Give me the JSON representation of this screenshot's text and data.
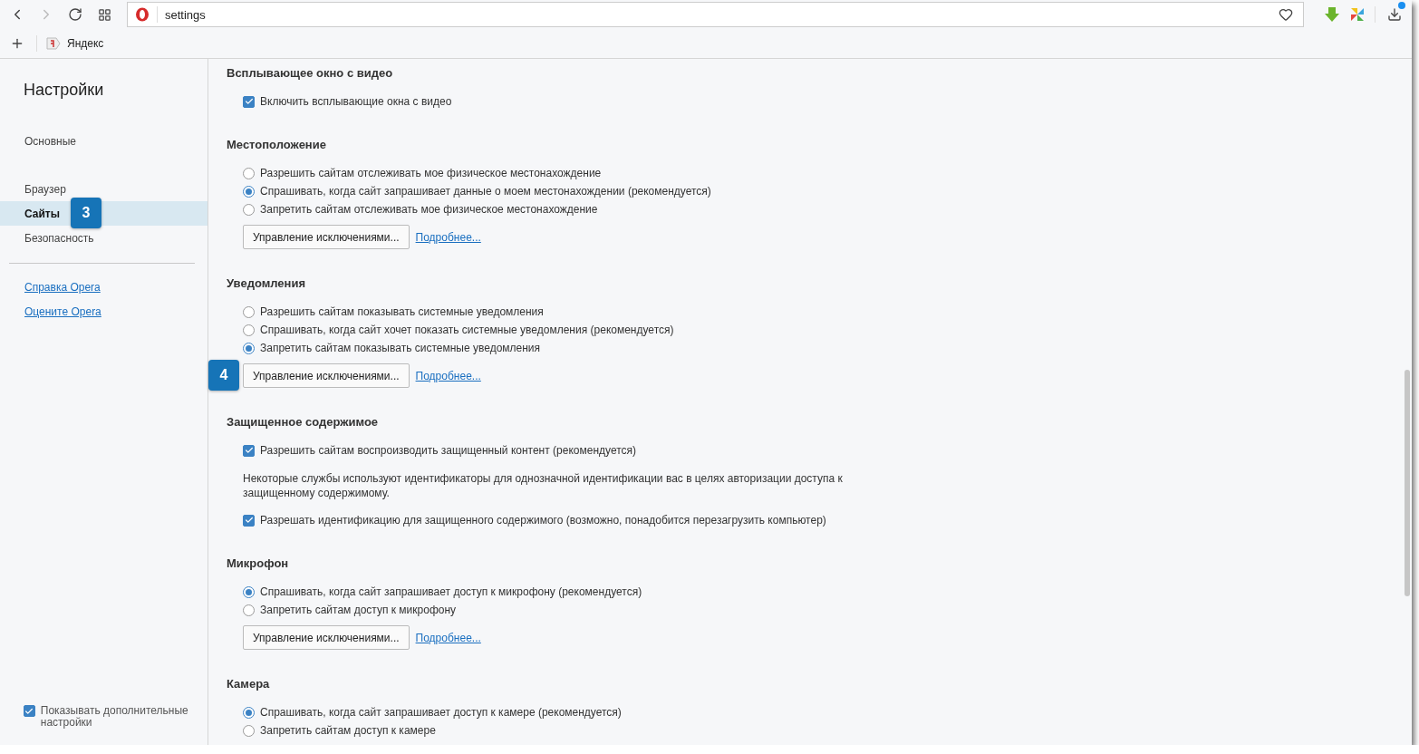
{
  "address_bar": {
    "value": "settings"
  },
  "bookmarks": [
    {
      "label": "Яндекс"
    }
  ],
  "sidebar": {
    "title": "Настройки",
    "items": [
      {
        "label": "Основные",
        "selected": false
      },
      {
        "label": "Браузер",
        "selected": false
      },
      {
        "label": "Сайты",
        "selected": true,
        "badge": "3"
      },
      {
        "label": "Безопасность",
        "selected": false
      }
    ],
    "links": [
      "Справка Opera",
      "Оцените Opera"
    ],
    "advanced": {
      "label": "Показывать дополнительные настройки",
      "checked": true
    }
  },
  "sections": [
    {
      "title": "Всплывающее окно с видео",
      "items": [
        {
          "kind": "checkbox",
          "label": "Включить всплывающие окна с видео",
          "checked": true
        }
      ]
    },
    {
      "title": "Местоположение",
      "items": [
        {
          "kind": "radio",
          "label": "Разрешить сайтам отслеживать мое физическое местонахождение",
          "selected": false
        },
        {
          "kind": "radio",
          "label": "Спрашивать, когда сайт запрашивает данные о моем местонахождении (рекомендуется)",
          "selected": true
        },
        {
          "kind": "radio",
          "label": "Запретить сайтам отслеживать мое физическое местонахождение",
          "selected": false
        },
        {
          "kind": "actions",
          "button": "Управление исключениями...",
          "link": "Подробнее..."
        }
      ]
    },
    {
      "title": "Уведомления",
      "items": [
        {
          "kind": "radio",
          "label": "Разрешить сайтам показывать системные уведомления",
          "selected": false
        },
        {
          "kind": "radio",
          "label": "Спрашивать, когда сайт хочет показать системные уведомления (рекомендуется)",
          "selected": false
        },
        {
          "kind": "radio",
          "label": "Запретить сайтам показывать системные уведомления",
          "selected": true
        },
        {
          "kind": "actions",
          "button": "Управление исключениями...",
          "link": "Подробнее...",
          "badge": "4"
        }
      ]
    },
    {
      "title": "Защищенное содержимое",
      "items": [
        {
          "kind": "checkbox",
          "label": "Разрешить сайтам воспроизводить защищенный контент (рекомендуется)",
          "checked": true
        },
        {
          "kind": "note",
          "label": "Некоторые службы используют идентификаторы для однозначной идентификации вас в целях авторизации доступа к защищенному содержимому."
        },
        {
          "kind": "checkbox",
          "label": "Разрешать идентификацию для защищенного содержимого (возможно, понадобится перезагрузить компьютер)",
          "checked": true
        }
      ]
    },
    {
      "title": "Микрофон",
      "items": [
        {
          "kind": "radio",
          "label": "Спрашивать, когда сайт запрашивает доступ к микрофону (рекомендуется)",
          "selected": true
        },
        {
          "kind": "radio",
          "label": "Запретить сайтам доступ к микрофону",
          "selected": false
        },
        {
          "kind": "actions",
          "button": "Управление исключениями...",
          "link": "Подробнее..."
        }
      ]
    },
    {
      "title": "Камера",
      "items": [
        {
          "kind": "radio",
          "label": "Спрашивать, когда сайт запрашивает доступ к камере (рекомендуется)",
          "selected": true
        },
        {
          "kind": "radio",
          "label": "Запретить сайтам доступ к камере",
          "selected": false
        }
      ]
    }
  ]
}
